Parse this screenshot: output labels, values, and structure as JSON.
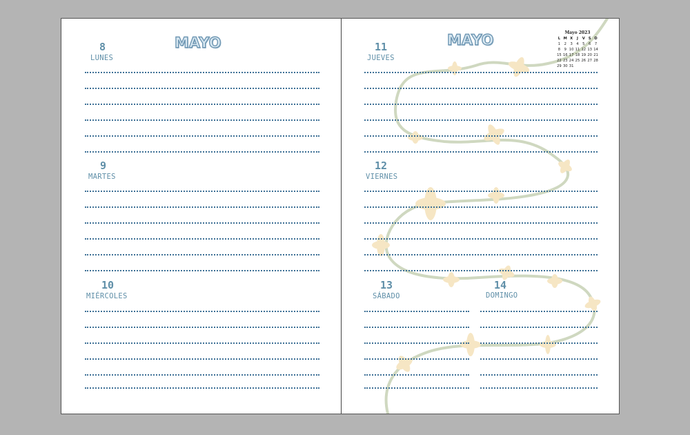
{
  "left_page": {
    "month_title": "MAYO",
    "days": [
      {
        "num": "8",
        "name": "LUNES"
      },
      {
        "num": "9",
        "name": "MARTES"
      },
      {
        "num": "10",
        "name": "MIÉRCOLES"
      }
    ]
  },
  "right_page": {
    "month_title": "MAYO",
    "days": [
      {
        "num": "11",
        "name": "JUEVES"
      },
      {
        "num": "12",
        "name": "VIERNES"
      },
      {
        "num": "13",
        "name": "SÁBADO"
      },
      {
        "num": "14",
        "name": "DOMINGO"
      }
    ],
    "mini_calendar": {
      "title": "Mayo 2023",
      "weekday_headers": [
        "L",
        "M",
        "X",
        "J",
        "V",
        "S",
        "D"
      ],
      "weeks": [
        [
          "1",
          "2",
          "3",
          "4",
          "5",
          "6",
          "7"
        ],
        [
          "8",
          "9",
          "10",
          "11",
          "12",
          "13",
          "14"
        ],
        [
          "15",
          "16",
          "17",
          "18",
          "19",
          "20",
          "21"
        ],
        [
          "22",
          "23",
          "24",
          "25",
          "26",
          "27",
          "28"
        ],
        [
          "29",
          "30",
          "31",
          "",
          "",
          "",
          ""
        ]
      ]
    }
  },
  "colors": {
    "background": "#b4b4b4",
    "page": "#ffffff",
    "day_text": "#5f8fa8",
    "dotted_line": "#3c6f95",
    "vine": "#cfd8c0",
    "flower": "#f6e6c4"
  }
}
